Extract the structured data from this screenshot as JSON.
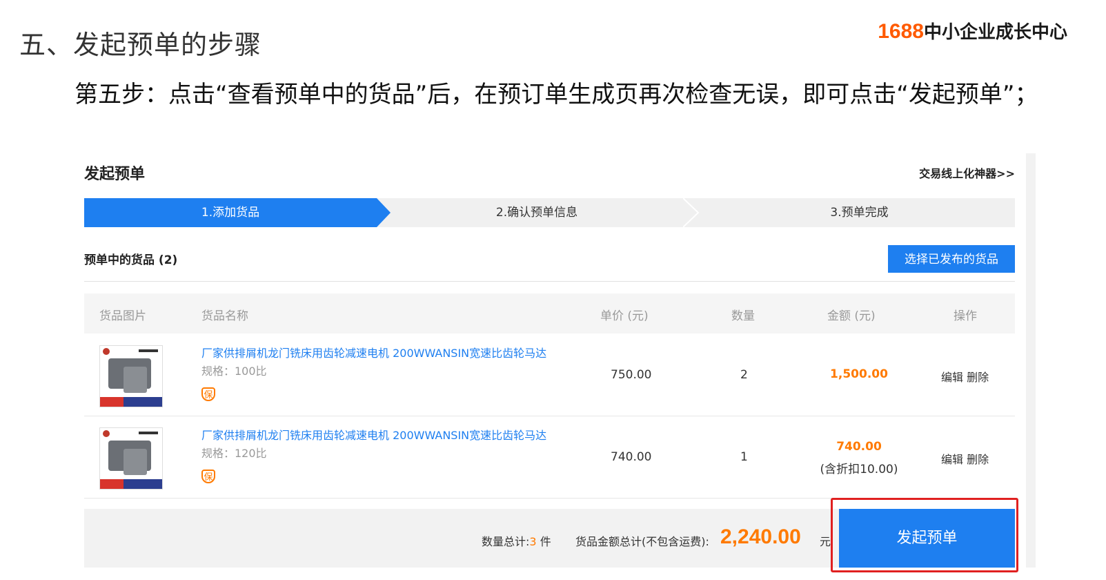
{
  "slide": {
    "title": "五、发起预单的步骤",
    "brand_num": "1688",
    "brand_text": "中小企业成长中心",
    "step_text": "第五步：点击“查看预单中的货品”后，在预订单生成页再次检查无误，即可点击“发起预单”；"
  },
  "panel": {
    "title": "发起预单",
    "link": "交易线上化神器>>",
    "steps": [
      "1.添加货品",
      "2.确认预单信息",
      "3.预单完成"
    ],
    "section_label": "预单中的货品 (2)",
    "select_button": "选择已发布的货品",
    "columns": [
      "货品图片",
      "货品名称",
      "单价 (元)",
      "数量",
      "金额 (元)",
      "操作"
    ],
    "rows": [
      {
        "name": "厂家供排屑机龙门铣床用齿轮减速电机 200WWANSIN宽速比齿轮马达",
        "spec": "规格：100比",
        "badge": "保",
        "price": "750.00",
        "qty": "2",
        "amount": "1,500.00",
        "discount": "",
        "edit": "编辑",
        "delete": "删除"
      },
      {
        "name": "厂家供排屑机龙门铣床用齿轮减速电机 200WWANSIN宽速比齿轮马达",
        "spec": "规格：120比",
        "badge": "保",
        "price": "740.00",
        "qty": "1",
        "amount": "740.00",
        "discount": "(含折扣10.00)",
        "edit": "编辑",
        "delete": "删除"
      }
    ],
    "footer": {
      "qty_label": "数量总计:",
      "qty_value": "3",
      "qty_unit": "件",
      "amount_label": "货品金额总计(不包含运费):",
      "total": "2,240.00",
      "currency": "元",
      "submit": "发起预单"
    }
  },
  "colors": {
    "accent": "#1e7ff0",
    "orange": "#ff7a00",
    "highlight_box": "#e02020",
    "brand_orange": "#ff5a00"
  }
}
